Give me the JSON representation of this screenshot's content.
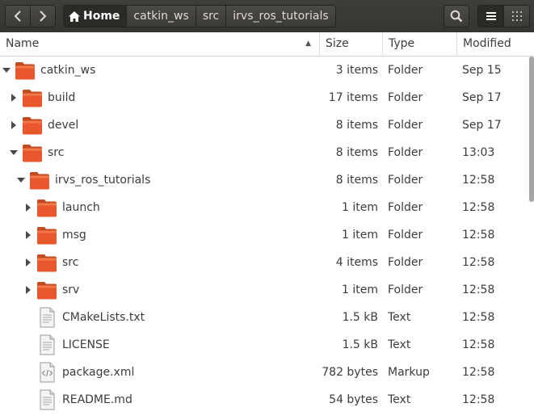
{
  "pathbar": {
    "home_label": "Home",
    "crumbs": [
      "catkin_ws",
      "src",
      "irvs_ros_tutorials"
    ]
  },
  "columns": {
    "name": "Name",
    "size": "Size",
    "type": "Type",
    "modified": "Modified"
  },
  "colors": {
    "folder": "#e8582c",
    "toolbar": "#3c3b37",
    "text": "#3c3c3c"
  },
  "rows": [
    {
      "name": "catkin_ws",
      "size": "3 items",
      "type": "Folder",
      "modified": "Sep 15",
      "kind": "folder",
      "expanded": true,
      "depth": 0
    },
    {
      "name": "build",
      "size": "17 items",
      "type": "Folder",
      "modified": "Sep 17",
      "kind": "folder",
      "expanded": false,
      "depth": 1
    },
    {
      "name": "devel",
      "size": "8 items",
      "type": "Folder",
      "modified": "Sep 17",
      "kind": "folder",
      "expanded": false,
      "depth": 1
    },
    {
      "name": "src",
      "size": "8 items",
      "type": "Folder",
      "modified": "13:03",
      "kind": "folder",
      "expanded": true,
      "depth": 1
    },
    {
      "name": "irvs_ros_tutorials",
      "size": "8 items",
      "type": "Folder",
      "modified": "12:58",
      "kind": "folder",
      "expanded": true,
      "depth": 2
    },
    {
      "name": "launch",
      "size": "1 item",
      "type": "Folder",
      "modified": "12:58",
      "kind": "folder",
      "expanded": false,
      "depth": 3
    },
    {
      "name": "msg",
      "size": "1 item",
      "type": "Folder",
      "modified": "12:58",
      "kind": "folder",
      "expanded": false,
      "depth": 3
    },
    {
      "name": "src",
      "size": "4 items",
      "type": "Folder",
      "modified": "12:58",
      "kind": "folder",
      "expanded": false,
      "depth": 3
    },
    {
      "name": "srv",
      "size": "1 item",
      "type": "Folder",
      "modified": "12:58",
      "kind": "folder",
      "expanded": false,
      "depth": 3
    },
    {
      "name": "CMakeLists.txt",
      "size": "1.5 kB",
      "type": "Text",
      "modified": "12:58",
      "kind": "text",
      "depth": 3
    },
    {
      "name": "LICENSE",
      "size": "1.5 kB",
      "type": "Text",
      "modified": "12:58",
      "kind": "text",
      "depth": 3
    },
    {
      "name": "package.xml",
      "size": "782 bytes",
      "type": "Markup",
      "modified": "12:58",
      "kind": "markup",
      "depth": 3
    },
    {
      "name": "README.md",
      "size": "54 bytes",
      "type": "Text",
      "modified": "12:58",
      "kind": "text",
      "depth": 3
    }
  ]
}
